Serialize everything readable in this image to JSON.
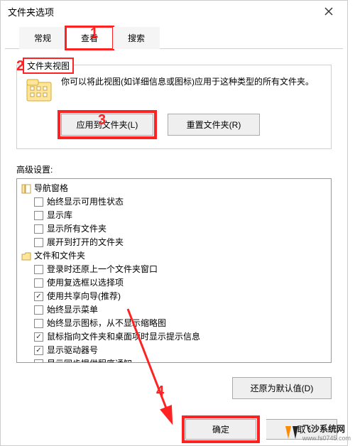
{
  "window": {
    "title": "文件夹选项"
  },
  "tabs": {
    "general": "常规",
    "view": "查看",
    "search": "搜索"
  },
  "folderViews": {
    "legend": "文件夹视图",
    "desc": "你可以将此视图(如详细信息或图标)应用于这种类型的所有文件夹。",
    "applyBtn": "应用到文件夹(L)",
    "resetBtn": "重置文件夹(R)"
  },
  "advanced": {
    "label": "高级设置:",
    "navRoot": "导航窗格",
    "navItems": [
      {
        "label": "始终显示可用性状态",
        "checked": false
      },
      {
        "label": "显示库",
        "checked": false
      },
      {
        "label": "显示所有文件夹",
        "checked": false
      },
      {
        "label": "展开到打开的文件夹",
        "checked": false
      }
    ],
    "filesRoot": "文件和文件夹",
    "fileItems": [
      {
        "label": "登录时还原上一个文件夹窗口",
        "checked": false
      },
      {
        "label": "使用复选框以选择项",
        "checked": false
      },
      {
        "label": "使用共享向导(推荐)",
        "checked": true
      },
      {
        "label": "始终显示菜单",
        "checked": false
      },
      {
        "label": "始终显示图标，从不显示缩略图",
        "checked": false
      },
      {
        "label": "鼠标指向文件夹和桌面项时显示提示信息",
        "checked": true
      },
      {
        "label": "显示驱动器号",
        "checked": true
      },
      {
        "label": "显示同步提供程序通知",
        "checked": false
      }
    ]
  },
  "restore": "还原为默认值(D)",
  "buttons": {
    "ok": "确定",
    "cancel": "取"
  },
  "annotations": {
    "a1": "1",
    "a2": "2",
    "a3": "3",
    "a4": "4"
  },
  "watermark": "飞沙系统网",
  "watermark_url": "www.fs0745.com"
}
